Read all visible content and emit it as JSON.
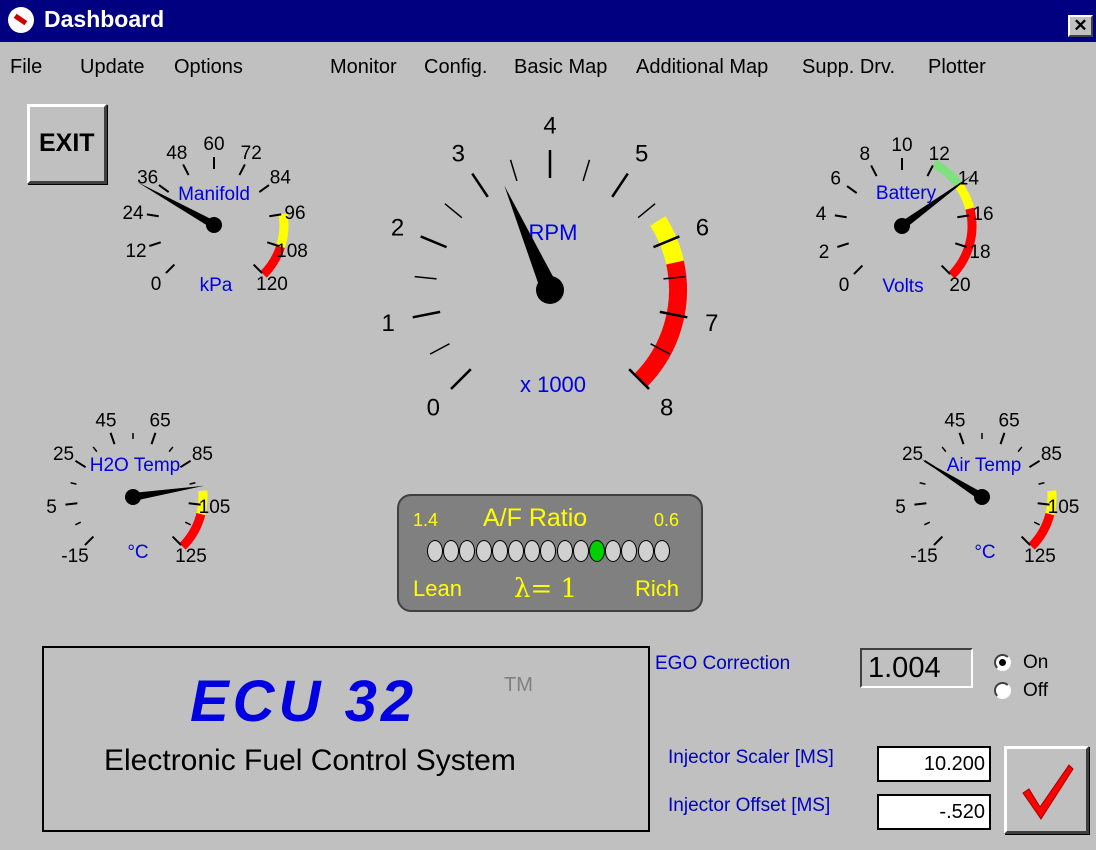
{
  "window": {
    "title": "Dashboard",
    "close_label": "✕"
  },
  "menu": {
    "left": [
      "File",
      "Update",
      "Options"
    ],
    "right": [
      "Monitor",
      "Config.",
      "Basic Map",
      "Additional Map",
      "Supp. Drv.",
      "Plotter"
    ]
  },
  "exit_label": "EXIT",
  "gauges": {
    "manifold": {
      "title": "Manifold",
      "unit": "kPa",
      "ticks": [
        "0",
        "12",
        "24",
        "36",
        "48",
        "60",
        "72",
        "84",
        "96",
        "108",
        "120"
      ],
      "value": 33
    },
    "rpm": {
      "title": "RPM",
      "unit": "x 1000",
      "ticks": [
        "0",
        "1",
        "2",
        "3",
        "4",
        "5",
        "6",
        "7",
        "8"
      ],
      "value": 3.3
    },
    "battery": {
      "title": "Battery",
      "unit": "Volts",
      "ticks": [
        "0",
        "2",
        "4",
        "6",
        "8",
        "10",
        "12",
        "14",
        "16",
        "18",
        "20"
      ],
      "value": 14
    },
    "h2o": {
      "title": "H2O Temp",
      "unit": "°C",
      "ticks": [
        "-15",
        "5",
        "25",
        "45",
        "65",
        "85",
        "105",
        "125"
      ],
      "value": 97
    },
    "air": {
      "title": "Air Temp",
      "unit": "°C",
      "ticks": [
        "-15",
        "5",
        "25",
        "45",
        "65",
        "85",
        "105",
        "125"
      ],
      "value": 25
    }
  },
  "af_ratio": {
    "title": "A/F Ratio",
    "left_value": "1.4",
    "right_value": "0.6",
    "lean_label": "Lean",
    "rich_label": "Rich",
    "lambda_label": "λ= 1",
    "led_count": 15,
    "active_index": 10
  },
  "branding": {
    "logo": "ECU 32",
    "tm": "TM",
    "subtitle": "Electronic Fuel Control System"
  },
  "ego": {
    "label": "EGO Correction",
    "value": "1.004",
    "on_label": "On",
    "off_label": "Off",
    "selected": "On"
  },
  "injector": {
    "scaler_label": "Injector Scaler [MS]",
    "scaler_value": "10.200",
    "offset_label": "Injector Offset [MS]",
    "offset_value": "-.520"
  },
  "colors": {
    "accent": "#0000e0",
    "titlebar": "#000080",
    "red": "#ff0000",
    "yellow": "#ffff00",
    "green": "#80e080"
  }
}
